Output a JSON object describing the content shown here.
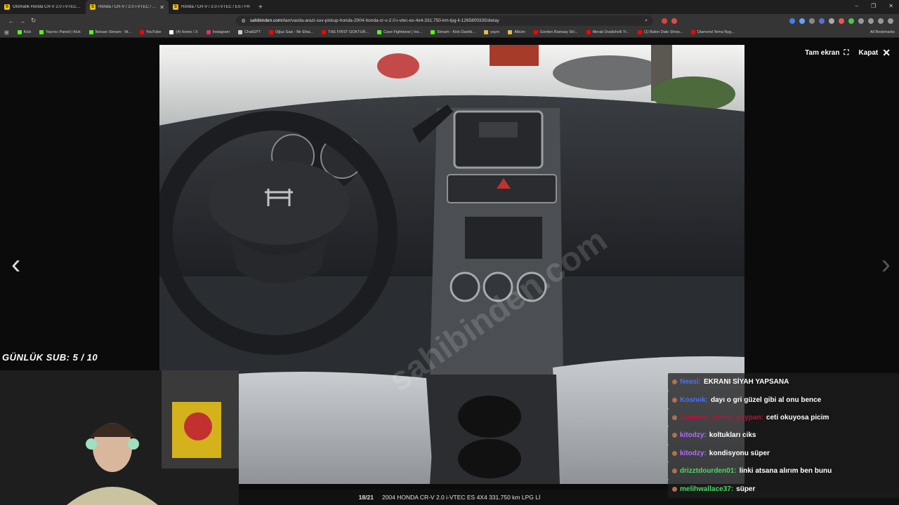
{
  "tabs": [
    {
      "label": "Otomatik Honda CR-V 2.0 i-VTEC Fiy",
      "active": false
    },
    {
      "label": "Honda / CR-V / 2.0 i-VTEC / ES /",
      "active": true
    },
    {
      "label": "Honda / CR-V / 2.0 i-VTEC / ES / FR",
      "active": false
    }
  ],
  "address_bar": {
    "url_host": "sahibinden.com",
    "url_path": "/ilan/vasita-arazi-suv-pickup-honda-2004-honda-cr-v-2.0-i-vtec-es-4x4-331.750-km-lpg-li-1265800335/detay"
  },
  "bookmarks": [
    {
      "label": "Kick",
      "color": "#53fc18"
    },
    {
      "label": "Yayıncı Paneli | Kick",
      "color": "#53fc18"
    },
    {
      "label": "İkinsan Stream - W...",
      "color": "#53fc18"
    },
    {
      "label": "YouTube",
      "color": "#ff0000"
    },
    {
      "label": "(4) Home / X",
      "color": "#ffffff"
    },
    {
      "label": "Instagram",
      "color": "#e1306c"
    },
    {
      "label": "ChatGPT",
      "color": "#cccccc"
    },
    {
      "label": "Oğuz Sasi - Bir Efsa...",
      "color": "#ff0000"
    },
    {
      "label": "THE FIRST GOKTUR...",
      "color": "#ff0000"
    },
    {
      "label": "Cave Fightwear | Ins...",
      "color": "#53fc18"
    },
    {
      "label": "Stream - Kick Dashb...",
      "color": "#53fc18"
    },
    {
      "label": "yayın",
      "color": "#e8b84a"
    },
    {
      "label": "Albüm",
      "color": "#e8b84a"
    },
    {
      "label": "Gordon Ramsay SH...",
      "color": "#ff0000"
    },
    {
      "label": "Merab Dvalishvili Tr...",
      "color": "#ff0000"
    },
    {
      "label": "(1) Balon Date Show...",
      "color": "#ff0000"
    },
    {
      "label": "Diamond Tema Nyg...",
      "color": "#ff0000"
    }
  ],
  "all_bookmarks_label": "All Bookmarks",
  "viewer": {
    "photo_id": "#1265800335",
    "fullscreen_label": "Tam ekran",
    "close_label": "Kapat",
    "counter": "18/21",
    "caption": "2004 HONDA CR-V 2.0 i-VTEC ES 4X4 331.750 km LPG Lİ",
    "watermark": "sahibinden.com"
  },
  "overlay": {
    "sub_goal": "GÜNLÜK SUB: 5 / 10"
  },
  "chat": [
    {
      "user": "Neasi:",
      "text": "EKRANI SİYAH YAPSANA",
      "color": "#4a6fff"
    },
    {
      "user": "Kosnok:",
      "text": "dayı o gri güzel gibi al onu bence",
      "color": "#4a6fff"
    },
    {
      "user": "Aponom_amina_paypan:",
      "text": "ceti okuyosa picim",
      "color": "#c0103a"
    },
    {
      "user": "kitodzy:",
      "text": "koltukları ciks",
      "color": "#b66cff"
    },
    {
      "user": "kitodzy:",
      "text": "kondisyonu süper",
      "color": "#b66cff"
    },
    {
      "user": "drizztdourden01:",
      "text": "linki atsana alırım ben bunu",
      "color": "#4cd964"
    },
    {
      "user": "melihwallace37:",
      "text": "süper",
      "color": "#4cd964"
    }
  ]
}
